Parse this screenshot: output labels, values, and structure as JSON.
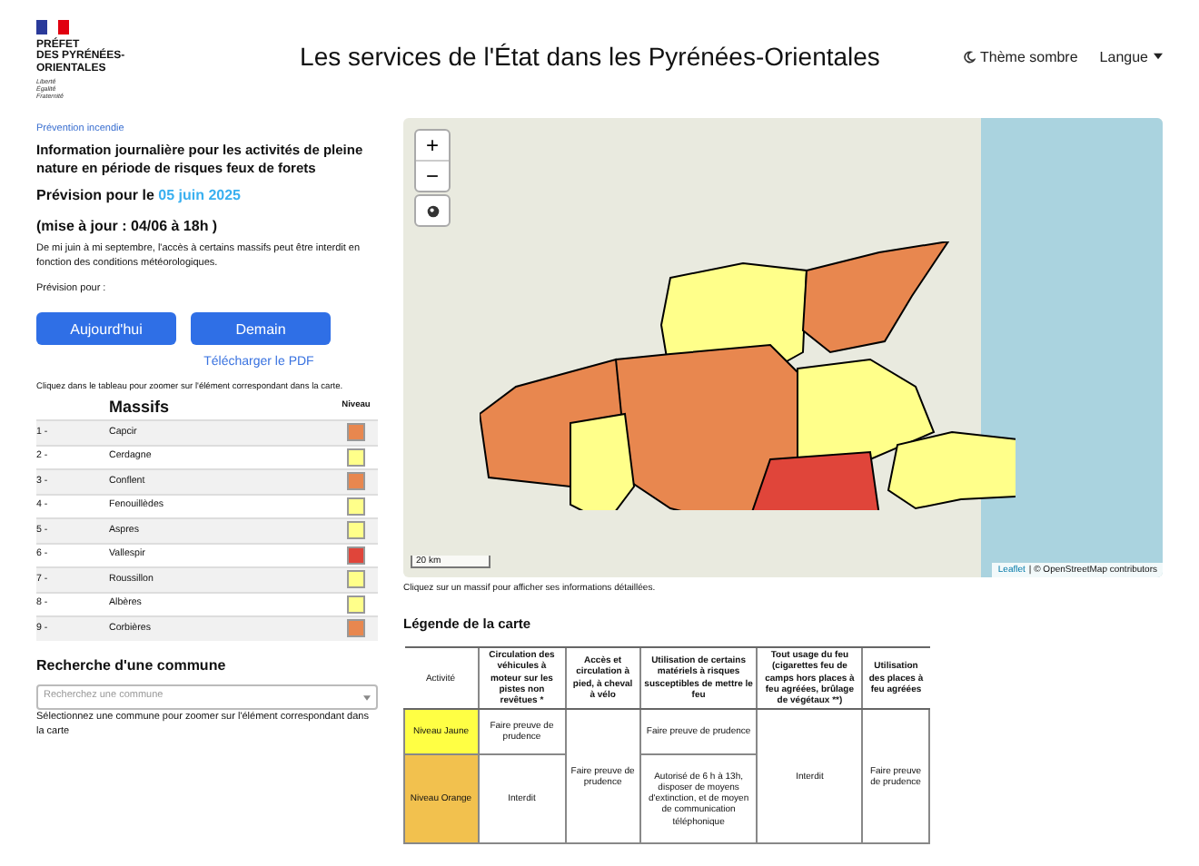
{
  "header": {
    "logo_lines": [
      "PRÉFET",
      "DES PYRÉNÉES-",
      "ORIENTALES"
    ],
    "motto": [
      "Liberté",
      "Égalité",
      "Fraternité"
    ],
    "title": "Les services de l'État dans les Pyrénées-Orientales",
    "theme_toggle": "Thème sombre",
    "language_menu": "Langue"
  },
  "sidebar": {
    "breadcrumb": "Prévention incendie",
    "heading": "Information journalière pour les activités de pleine nature en période de risques feux de forets",
    "forecast_label": "Prévision pour le",
    "forecast_date": "05 juin 2025",
    "update": "(mise à jour : 04/06 à 18h )",
    "notice": "De mi juin à mi septembre, l'accès à certains massifs peut être interdit en fonction des conditions météorologiques.",
    "forecast_for": "Prévision pour :",
    "buttons": [
      "Aujourd'hui",
      "Demain"
    ],
    "pdf_link": "Télécharger le PDF",
    "table_hint": "Cliquez dans le tableau pour zoomer sur l'élément correspondant dans la carte.",
    "massifs_heading": "Massifs",
    "level_heading": "Niveau",
    "massifs": [
      {
        "number": "1 -",
        "name": "Capcir",
        "color": "#e8874f"
      },
      {
        "number": "2 -",
        "name": "Cerdagne",
        "color": "#ffff8a"
      },
      {
        "number": "3 -",
        "name": "Conflent",
        "color": "#e8874f"
      },
      {
        "number": "4 -",
        "name": "Fenouillèdes",
        "color": "#ffff8a"
      },
      {
        "number": "5 -",
        "name": "Aspres",
        "color": "#ffff8a"
      },
      {
        "number": "6 -",
        "name": "Vallespir",
        "color": "#e0453a"
      },
      {
        "number": "7 -",
        "name": "Roussillon",
        "color": "#ffff8a"
      },
      {
        "number": "8 -",
        "name": "Albères",
        "color": "#ffff8a"
      },
      {
        "number": "9 -",
        "name": "Corbières",
        "color": "#e8874f"
      }
    ],
    "commune_heading": "Recherche d'une commune",
    "commune_search": {
      "placeholder": "Recherchez une commune"
    },
    "commune_hint": "Sélectionnez une commune pour zoomer sur l'élément correspondant dans la carte"
  },
  "map": {
    "zoom_in": "+",
    "zoom_out": "−",
    "scale": "20 km",
    "attribution_link": "Leaflet",
    "attribution_text": "| © OpenStreetMap contributors",
    "caption": "Cliquez sur un massif pour afficher ses informations détaillées."
  },
  "legend": {
    "title": "Légende de la carte",
    "columns": [
      "Activité",
      "Circulation des véhicules à moteur sur les pistes non revêtues *",
      "Accès et circulation à pied, à cheval à vélo",
      "Utilisation de certains matériels à risques susceptibles de mettre le feu",
      "Tout usage du feu (cigarettes feu de camps hors places à feu agréées, brûlage de végétaux **)",
      "Utilisation des places à feu agréées"
    ],
    "rows": [
      {
        "color": "#ffff44",
        "cells": [
          {
            "text": "Niveau Jaune",
            "kind": "level"
          },
          {
            "text": "Faire preuve de prudence",
            "kind": "text"
          },
          {
            "text": "Faire preuve de prudence",
            "kind": "text",
            "rowspan": 2
          },
          {
            "text": "Faire preuve de prudence",
            "kind": "text"
          },
          {
            "text": "Interdit",
            "kind": "text",
            "rowspan": 2
          },
          {
            "text": "Faire preuve de prudence",
            "kind": "text",
            "rowspan": 2
          }
        ]
      },
      {
        "color": "#f2c14e",
        "cells": [
          {
            "text": "Niveau Orange",
            "kind": "level"
          },
          {
            "text": "Interdit",
            "kind": "text"
          },
          {
            "text": "Autorisé de 6 h à 13h, disposer de moyens d'extinction, et de moyen de communication téléphonique",
            "kind": "text"
          }
        ]
      }
    ]
  }
}
